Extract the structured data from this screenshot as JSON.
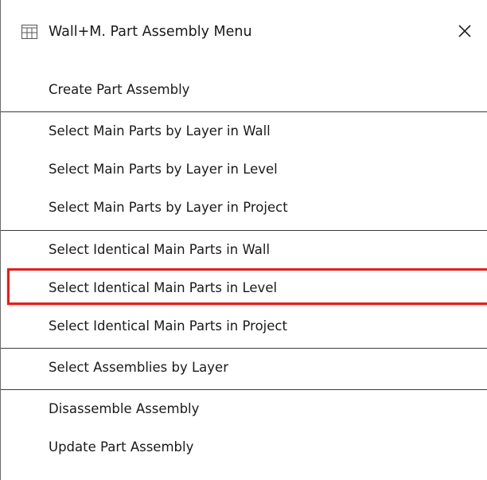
{
  "window": {
    "title": "Wall+M. Part Assembly Menu",
    "app_icon": "grid-window-icon",
    "close_icon": "close-icon",
    "close_glyph": "✕"
  },
  "menu": {
    "items": [
      {
        "label": "Create Part Assembly"
      },
      {
        "label": "Select Main Parts by Layer in Wall"
      },
      {
        "label": "Select Main Parts by Layer in Level"
      },
      {
        "label": "Select Main Parts by Layer in Project"
      },
      {
        "label": "Select Identical Main Parts in Wall"
      },
      {
        "label": "Select Identical Main Parts in Level"
      },
      {
        "label": "Select Identical Main Parts in Project"
      },
      {
        "label": "Select Assemblies by Layer"
      },
      {
        "label": "Disassemble Assembly"
      },
      {
        "label": "Update Part Assembly"
      }
    ]
  },
  "highlight": {
    "item": "Select Identical Main Parts in Level",
    "color": "#e0201c"
  }
}
